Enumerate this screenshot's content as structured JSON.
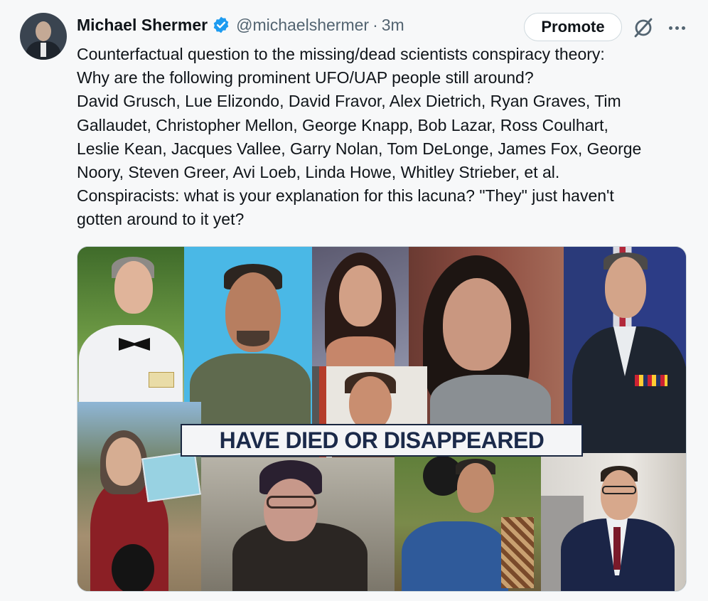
{
  "author": {
    "name": "Michael Shermer",
    "handle": "@michaelshermer",
    "separator": "·",
    "time": "3m",
    "verified_color": "#1d9bf0"
  },
  "actions": {
    "promote_label": "Promote",
    "grok_icon": "slashed-circle-icon",
    "more_icon": "more-dots-icon"
  },
  "tweet": {
    "lines": [
      "Counterfactual question to the missing/dead scientists conspiracy theory:",
      "Why are the following prominent UFO/UAP people still around?",
      "David Grusch, Lue Elizondo, David Fravor, Alex Dietrich, Ryan Graves, Tim",
      "Gallaudet, Christopher Mellon, George Knapp, Bob Lazar, Ross Coulhart,",
      "Leslie Kean, Jacques Vallee, Garry Nolan, Tom DeLonge, James Fox, George",
      "Noory, Steven Greer, Avi Loeb, Linda Howe, Whitley Strieber, et al.",
      "Conspiracists: what is your explanation for this lacuna? \"They\" just haven't",
      "gotten around to it yet?"
    ]
  },
  "media": {
    "banner_text": "HAVE DIED OR DISAPPEARED"
  }
}
